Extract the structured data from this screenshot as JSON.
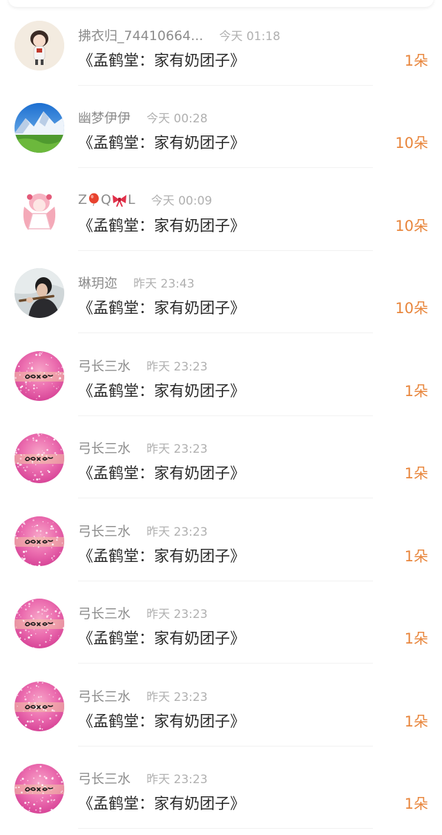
{
  "rows": [
    {
      "username": "拂衣归_74410664...",
      "time": "今天 01:18",
      "gift": "《孟鹤堂：家有奶团子》",
      "count": "1朵",
      "avatar": "anime-chibi-boy"
    },
    {
      "username": "幽梦伊伊",
      "time": "今天 00:28",
      "gift": "《孟鹤堂：家有奶团子》",
      "count": "10朵",
      "avatar": "mountain-landscape"
    },
    {
      "username_parts": [
        "Z",
        "Q",
        "L"
      ],
      "time": "今天 00:09",
      "gift": "《孟鹤堂：家有奶团子》",
      "count": "10朵",
      "avatar": "pink-anime-girl"
    },
    {
      "username": "琳玥迩",
      "time": "昨天 23:43",
      "gift": "《孟鹤堂：家有奶团子》",
      "count": "10朵",
      "avatar": "man-playing-flute"
    },
    {
      "username": "弓长三水",
      "time": "昨天 23:23",
      "gift": "《孟鹤堂：家有奶团子》",
      "count": "1朵",
      "avatar": "pink-glitter-name"
    },
    {
      "username": "弓长三水",
      "time": "昨天 23:23",
      "gift": "《孟鹤堂：家有奶团子》",
      "count": "1朵",
      "avatar": "pink-glitter-name"
    },
    {
      "username": "弓长三水",
      "time": "昨天 23:23",
      "gift": "《孟鹤堂：家有奶团子》",
      "count": "1朵",
      "avatar": "pink-glitter-name"
    },
    {
      "username": "弓长三水",
      "time": "昨天 23:23",
      "gift": "《孟鹤堂：家有奶团子》",
      "count": "1朵",
      "avatar": "pink-glitter-name"
    },
    {
      "username": "弓长三水",
      "time": "昨天 23:23",
      "gift": "《孟鹤堂：家有奶团子》",
      "count": "1朵",
      "avatar": "pink-glitter-name"
    },
    {
      "username": "弓长三水",
      "time": "昨天 23:23",
      "gift": "《孟鹤堂：家有奶团子》",
      "count": "1朵",
      "avatar": "pink-glitter-name"
    }
  ],
  "colors": {
    "count": "#e8853b",
    "username": "#8c8c8c",
    "time": "#b0b0b0",
    "gift": "#2b2b2b"
  },
  "emoji_icons": [
    "balloon-icon",
    "bow-icon"
  ]
}
